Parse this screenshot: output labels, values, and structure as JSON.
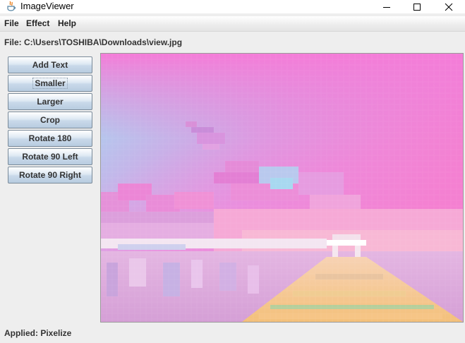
{
  "window": {
    "title": "ImageViewer"
  },
  "menu": {
    "items": [
      {
        "label": "File"
      },
      {
        "label": "Effect"
      },
      {
        "label": "Help"
      }
    ]
  },
  "file_path": "File: C:\\Users\\TOSHIBA\\Downloads\\view.jpg",
  "buttons": [
    {
      "label": "Add Text"
    },
    {
      "label": "Smaller",
      "focused": true
    },
    {
      "label": "Larger"
    },
    {
      "label": "Crop"
    },
    {
      "label": "Rotate 180"
    },
    {
      "label": "Rotate 90 Left"
    },
    {
      "label": "Rotate 90 Right"
    }
  ],
  "image": {
    "description_colors": {
      "sky_top": "#f07fd8",
      "sky_blue": "#8fd6ec",
      "cloud_pink": "#e987d6",
      "water": "#dca6dd",
      "pier": "#f3c58a"
    }
  },
  "status": "Applied: Pixelize"
}
